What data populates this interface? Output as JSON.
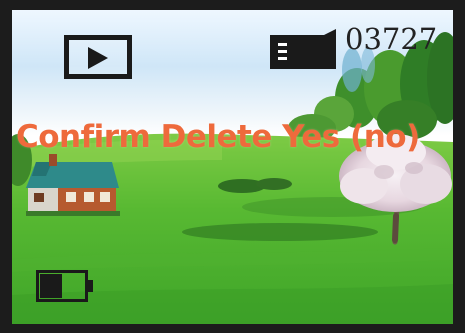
{
  "screen": {
    "mode_icon": "playback-icon",
    "storage_icon": "sd-card-icon",
    "file_counter": "03727",
    "confirm_message": "Confirm Delete Yes (no)",
    "battery_icon": "battery-icon",
    "battery_level": 0.5
  },
  "colors": {
    "message": "#ee6a3c",
    "icons": "#1a1a1a",
    "frame": "#1c1c1c"
  }
}
